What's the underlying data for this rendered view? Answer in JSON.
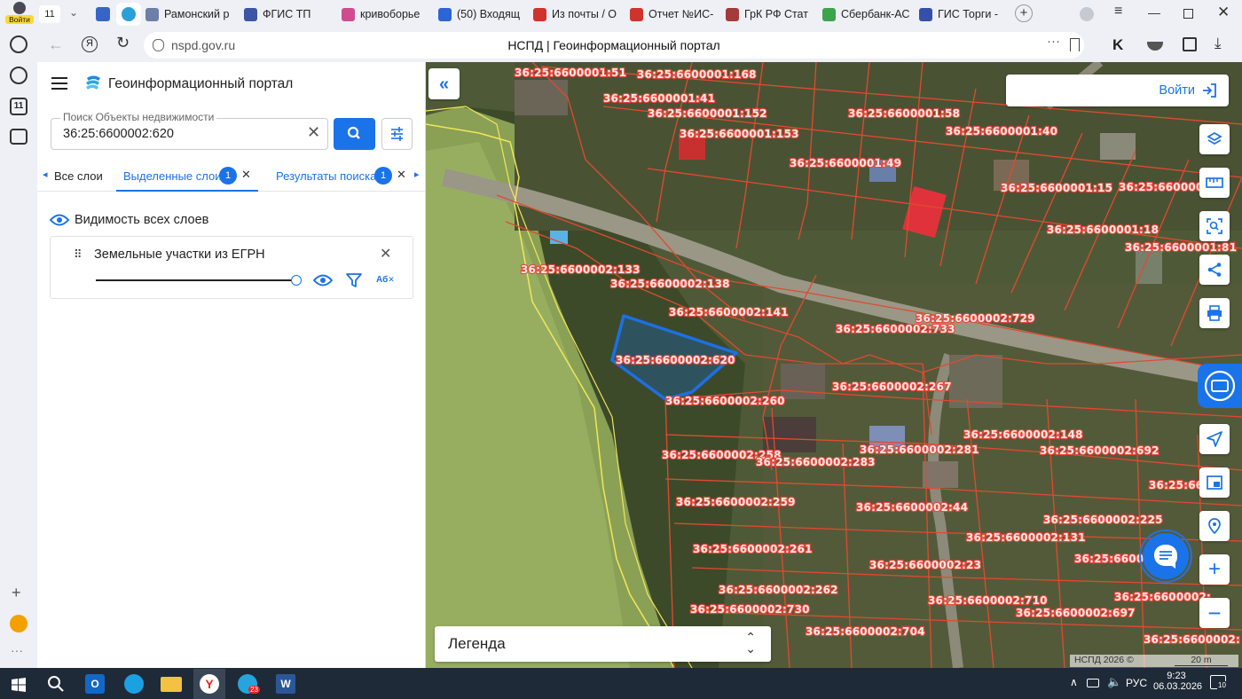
{
  "browser": {
    "profile_label": "Войти",
    "tab_count": "11",
    "tabs": [
      {
        "title": "Рамонский р",
        "color": "#6d7fa6"
      },
      {
        "title": "ФГИС ТП",
        "color": "#3c56a5"
      },
      {
        "title": "кривоборье",
        "color": "#cf4c8e"
      },
      {
        "title": "(50) Входящ",
        "color": "#2d65d7"
      },
      {
        "title": "Из почты / О",
        "color": "#d0332d"
      },
      {
        "title": "Отчет №ИС-",
        "color": "#d0332d"
      },
      {
        "title": "ГрК РФ Стат",
        "color": "#a43a3a"
      },
      {
        "title": "Сбербанк-АС",
        "color": "#3ea34d"
      },
      {
        "title": "ГИС Торги -",
        "color": "#3550a8"
      }
    ],
    "url": "nspd.gov.ru",
    "page_title": "НСПД | Геоинформационный портал"
  },
  "sidebar": {
    "calendar_day": "11"
  },
  "panel": {
    "portal_title": "Геоинформационный портал",
    "search_label": "Поиск Объекты недвижимости",
    "search_value": "36:25:6600002:620",
    "tabs": [
      {
        "label": "Все слои",
        "badge": ""
      },
      {
        "label": "Выделенные слои",
        "badge": "1"
      },
      {
        "label": "Результаты поиска",
        "badge": "1"
      }
    ],
    "visibility_label": "Видимость всех слоев",
    "layer_name": "Земельные участки из ЕГРН",
    "layer_opacity": 1.0,
    "label_icon_text": "Аб"
  },
  "map": {
    "login_label": "Войти",
    "legend_label": "Легенда",
    "copyright": "НСПД 2026 ©",
    "scale_text": "20 m",
    "selected_parcel": "36:25:6600002:620",
    "parcel_labels": [
      "36:25:6600001:51",
      "36:25:6600001:168",
      "36:25:6600001:41",
      "36:25:6600001:152",
      "36:25:6600001:58",
      "36:25:6600001:40",
      "36:25:6600001:153",
      "36:25:6600001:49",
      "36:25:6600001:15",
      "36:25:6600001:0",
      "36:25:6600001:18",
      "36:25:6600001:81",
      "36:25:6600002:133",
      "36:25:6600002:138",
      "36:25:6600002:141",
      "36:25:6600002:729",
      "36:25:6600002:733",
      "36:25:6600002:620",
      "36:25:6600002:267",
      "36:25:6600002:260",
      "36:25:6600002:148",
      "36:25:6600002:692",
      "36:25:6600002:258",
      "36:25:6600002:283",
      "36:25:6600002:281",
      "36:25:66",
      "36:25:6600002:259",
      "36:25:6600002:44",
      "36:25:6600002:225",
      "36:25:6600002:131",
      "36:25:6600002:261",
      "36:25:6600002:23",
      "36:25:660000",
      "36:25:6600002:262",
      "36:25:6600002:710",
      "36:25:6600002:",
      "36:25:6600002:730",
      "36:25:6600002:697",
      "36:25:6600002:704",
      "36:25:6600002:"
    ]
  },
  "taskbar": {
    "telegram_badge": "23",
    "lang": "РУС",
    "time": "9:23",
    "date": "06.03.2026",
    "notif": "10"
  }
}
